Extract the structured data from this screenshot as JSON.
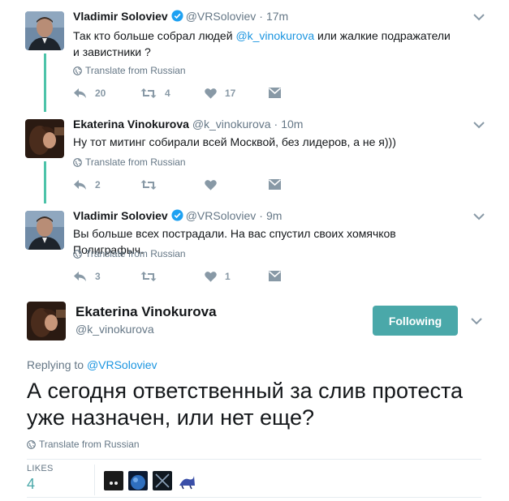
{
  "tweets": [
    {
      "name": "Vladimir Soloviev",
      "handle": "@VRSoloviev",
      "time": "17m",
      "text_before": "Так кто больше собрал людей ",
      "mention": "@k_vinokurova",
      "text_after": "  или жалкие подражатели и завистники ?",
      "translate": "Translate from Russian",
      "replies": "20",
      "retweets": "4",
      "likes": "17"
    },
    {
      "name": "Ekaterina Vinokurova",
      "handle": "@k_vinokurova",
      "time": "10m",
      "text": "Ну тот митинг собирали всей Москвой, без лидеров, а не я)))",
      "translate": "Translate from Russian",
      "replies": "2",
      "retweets": "",
      "likes": ""
    },
    {
      "name": "Vladimir Soloviev",
      "handle": "@VRSoloviev",
      "time": "9m",
      "text": "Вы больше всех пострадали. На вас спустил своих хомячков Полиграфыч.",
      "translate": "Translate from Russian",
      "replies": "3",
      "retweets": "",
      "likes": "1"
    }
  ],
  "main_tweet": {
    "name": "Ekaterina Vinokurova",
    "handle": "@k_vinokurova",
    "follow_label": "Following",
    "replying_prefix": "Replying to ",
    "replying_to": "@VRSoloviev",
    "text": "А сегодня ответственный за слив протеста уже назначен, или нет еще?",
    "translate": "Translate from Russian",
    "likes_label": "LIKES",
    "likes_count": "4"
  },
  "colors": {
    "accent": "#4aa8a9",
    "thread_line": "#4dc3a9",
    "link": "#1b95e0",
    "muted": "#657786",
    "icon": "#8899a6"
  },
  "icons": [
    "verified-badge-icon",
    "globe-icon",
    "reply-icon",
    "retweet-icon",
    "heart-icon",
    "direct-message-icon",
    "chevron-down-icon"
  ]
}
